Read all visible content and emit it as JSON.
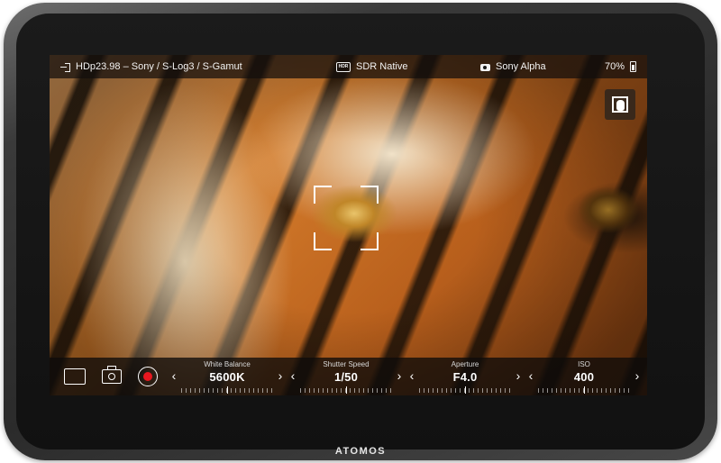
{
  "device": {
    "brand": "ATOMOS"
  },
  "status_bar": {
    "input_source": "HDp23.98 – Sony / S-Log3 / S-Gamut",
    "display_mode": "SDR Native",
    "camera": "Sony Alpha",
    "battery": "70%",
    "icons": [
      "input-icon",
      "hdr-icon",
      "camera-icon",
      "battery-icon"
    ]
  },
  "overlay": {
    "fullscreen_icon": "fullscreen-touch-icon",
    "focus_frame": "af-frame"
  },
  "controls": {
    "buttons": [
      "monitor-mode-icon",
      "snapshot-camera-icon",
      "record-icon"
    ],
    "record_color": "#e8171f",
    "params": {
      "white_balance": {
        "label": "White Balance",
        "value": "5600K"
      },
      "shutter_speed": {
        "label": "Shutter Speed",
        "value": "1/50"
      },
      "aperture": {
        "label": "Aperture",
        "value": "F4.0"
      },
      "iso": {
        "label": "ISO",
        "value": "400"
      }
    },
    "arrows": {
      "left": "‹",
      "right": "›"
    }
  }
}
